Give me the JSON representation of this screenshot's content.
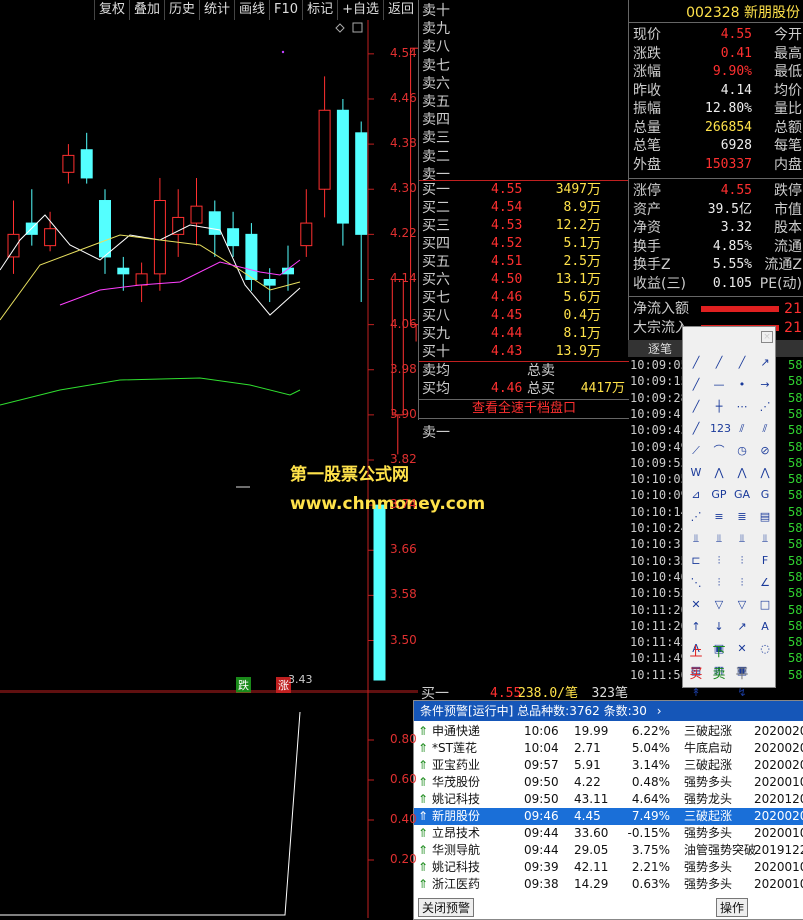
{
  "toolbar": [
    "复权",
    "叠加",
    "历史",
    "统计",
    "画线",
    "F10",
    "标记",
    "+自选",
    "返回"
  ],
  "price_axis": [
    "4.54",
    "4.46",
    "4.38",
    "4.30",
    "4.22",
    "4.14",
    "4.06",
    "3.98",
    "3.90",
    "3.82",
    "3.74",
    "3.66",
    "3.58",
    "3.50"
  ],
  "vol_axis": [
    "0.80",
    "0.60",
    "0.40",
    "0.20"
  ],
  "chart_marks": {
    "low_label": "3.43",
    "fall_tag": "跌",
    "rise_tag": "涨"
  },
  "watermark": {
    "line1": "第一股票公式网",
    "line2": "www.chnmoney.com"
  },
  "chart_data": {
    "type": "candlestick",
    "candles": [
      {
        "o": 4.18,
        "c": 4.22,
        "h": 4.28,
        "l": 4.15
      },
      {
        "o": 4.24,
        "c": 4.22,
        "h": 4.3,
        "l": 4.2
      },
      {
        "o": 4.2,
        "c": 4.23,
        "h": 4.26,
        "l": 4.19
      },
      {
        "o": 4.33,
        "c": 4.36,
        "h": 4.38,
        "l": 4.31
      },
      {
        "o": 4.37,
        "c": 4.32,
        "h": 4.4,
        "l": 4.31
      },
      {
        "o": 4.28,
        "c": 4.18,
        "h": 4.3,
        "l": 4.15
      },
      {
        "o": 4.16,
        "c": 4.15,
        "h": 4.18,
        "l": 4.12
      },
      {
        "o": 4.13,
        "c": 4.15,
        "h": 4.17,
        "l": 4.1
      },
      {
        "o": 4.15,
        "c": 4.28,
        "h": 4.32,
        "l": 4.12
      },
      {
        "o": 4.22,
        "c": 4.25,
        "h": 4.3,
        "l": 4.18
      },
      {
        "o": 4.24,
        "c": 4.27,
        "h": 4.32,
        "l": 4.2
      },
      {
        "o": 4.26,
        "c": 4.22,
        "h": 4.28,
        "l": 4.18
      },
      {
        "o": 4.23,
        "c": 4.2,
        "h": 4.26,
        "l": 4.18
      },
      {
        "o": 4.22,
        "c": 4.14,
        "h": 4.24,
        "l": 4.12
      },
      {
        "o": 4.14,
        "c": 4.13,
        "h": 4.16,
        "l": 4.1
      },
      {
        "o": 4.16,
        "c": 4.15,
        "h": 4.2,
        "l": 4.12
      },
      {
        "o": 4.2,
        "c": 4.24,
        "h": 4.3,
        "l": 4.18
      },
      {
        "o": 4.3,
        "c": 4.44,
        "h": 4.5,
        "l": 4.25
      },
      {
        "o": 4.44,
        "c": 4.24,
        "h": 4.46,
        "l": 4.2
      },
      {
        "o": 4.4,
        "c": 4.22,
        "h": 4.42,
        "l": 4.1
      },
      {
        "o": 3.74,
        "c": 3.43,
        "h": 3.74,
        "l": 3.43
      },
      {
        "o": 3.9,
        "c": 4.14,
        "h": 4.14,
        "l": 3.83
      },
      {
        "o": 4.06,
        "c": 4.55,
        "h": 4.55,
        "l": 4.03
      }
    ]
  },
  "stock": {
    "code": "002328",
    "name": "新朋股份"
  },
  "orderbook": {
    "sells": [
      "卖十",
      "卖九",
      "卖八",
      "卖七",
      "卖六",
      "卖五",
      "卖四",
      "卖三",
      "卖二",
      "卖一"
    ],
    "buys": [
      {
        "label": "买一",
        "price": "4.55",
        "vol": "3497"
      },
      {
        "label": "买二",
        "price": "4.54",
        "vol": "8.9"
      },
      {
        "label": "买三",
        "price": "4.53",
        "vol": "12.2"
      },
      {
        "label": "买四",
        "price": "4.52",
        "vol": "5.1"
      },
      {
        "label": "买五",
        "price": "4.51",
        "vol": "2.5"
      },
      {
        "label": "买六",
        "price": "4.50",
        "vol": "13.1"
      },
      {
        "label": "买七",
        "price": "4.46",
        "vol": "5.6"
      },
      {
        "label": "买八",
        "price": "4.45",
        "vol": "0.4"
      },
      {
        "label": "买九",
        "price": "4.44",
        "vol": "8.1"
      },
      {
        "label": "买十",
        "price": "4.43",
        "vol": "13.9"
      }
    ],
    "unit": "万",
    "sell_avg_label": "卖均",
    "total_sell_label": "总卖",
    "buy_avg_label": "买均",
    "buy_avg": "4.46",
    "total_buy_label": "总买",
    "total_buy": "4417万",
    "view_link": "查看全速千档盘口",
    "sell_one_label": "卖一",
    "bottom_row": {
      "label": "买一",
      "price": "4.55",
      "vol": "238.0/笔",
      "extra": "323笔"
    }
  },
  "quote": [
    {
      "l": "现价",
      "v": "4.55",
      "c": "red",
      "l2": "今开"
    },
    {
      "l": "涨跌",
      "v": "0.41",
      "c": "red",
      "l2": "最高"
    },
    {
      "l": "涨幅",
      "v": "9.90%",
      "c": "red",
      "l2": "最低"
    },
    {
      "l": "昨收",
      "v": "4.14",
      "c": "wht",
      "l2": "均价"
    },
    {
      "l": "振幅",
      "v": "12.80%",
      "c": "wht",
      "l2": "量比"
    },
    {
      "l": "总量",
      "v": "266854",
      "c": "yel",
      "l2": "总额"
    },
    {
      "l": "总笔",
      "v": "6928",
      "c": "wht",
      "l2": "每笔"
    },
    {
      "l": "外盘",
      "v": "150337",
      "c": "red",
      "l2": "内盘"
    },
    {
      "l": "涨停",
      "v": "4.55",
      "c": "red",
      "l2": "跌停"
    },
    {
      "l": "资产",
      "v": "39.5亿",
      "c": "wht",
      "l2": "市值"
    },
    {
      "l": "净资",
      "v": "3.32",
      "c": "wht",
      "l2": "股本"
    },
    {
      "l": "换手",
      "v": "4.85%",
      "c": "wht",
      "l2": "流通"
    },
    {
      "l": "换手Z",
      "v": "5.55%",
      "c": "wht",
      "l2": "流通Z"
    },
    {
      "l": "收益(三)",
      "v": "0.105",
      "c": "wht",
      "l2": "PE(动)"
    }
  ],
  "flow": [
    {
      "label": "净流入额",
      "value": "21"
    },
    {
      "label": "大宗流入",
      "value": "21"
    }
  ],
  "ticks_title": "逐笔",
  "ticks": [
    "10:09:05",
    "10:09:15",
    "10:09:28",
    "10:09:41",
    "10:09:43",
    "10:09:49",
    "10:09:53",
    "10:10:05",
    "10:10:09",
    "10:10:14",
    "10:10:24",
    "10:10:31",
    "10:10:35",
    "10:10:40",
    "10:10:52",
    "10:11:20",
    "10:11:26",
    "10:11:42",
    "10:11:49",
    "10:11:56"
  ],
  "toolbox": {
    "up": "上",
    "down": "下",
    "buy": "买",
    "sell": "卖",
    "flat": "平"
  },
  "alerts": {
    "title": "条件预警[运行中] 总品种数:3762 条数:30",
    "rows": [
      {
        "name": "申通快递",
        "time": "10:06",
        "price": "19.99",
        "pct": "6.22%",
        "sig": "三破起涨",
        "date": "20200204"
      },
      {
        "name": "*ST莲花",
        "time": "10:04",
        "price": "2.71",
        "pct": "5.04%",
        "sig": "牛底启动",
        "date": "20200203"
      },
      {
        "name": "亚宝药业",
        "time": "09:57",
        "price": "5.91",
        "pct": "3.14%",
        "sig": "三破起涨",
        "date": "20200204"
      },
      {
        "name": "华茂股份",
        "time": "09:50",
        "price": "4.22",
        "pct": "0.48%",
        "sig": "强势多头",
        "date": "20200104"
      },
      {
        "name": "姚记科技",
        "time": "09:50",
        "price": "43.11",
        "pct": "4.64%",
        "sig": "强势龙头",
        "date": "2020120-自"
      },
      {
        "name": "新朋股份",
        "time": "09:46",
        "price": "4.45",
        "pct": "7.49%",
        "sig": "三破起涨",
        "date": "20200204"
      },
      {
        "name": "立昂技术",
        "time": "09:44",
        "price": "33.60",
        "pct": "-0.15%",
        "sig": "强势多头",
        "date": "20200104-自"
      },
      {
        "name": "华测导航",
        "time": "09:44",
        "price": "29.05",
        "pct": "3.75%",
        "sig": "油管强势突破",
        "date": "2019122"
      },
      {
        "name": "姚记科技",
        "time": "09:39",
        "price": "42.11",
        "pct": "2.21%",
        "sig": "强势多头",
        "date": "20200104-自"
      },
      {
        "name": "浙江医药",
        "time": "09:38",
        "price": "14.29",
        "pct": "0.63%",
        "sig": "强势多头",
        "date": "20200104"
      }
    ],
    "close_btn": "关闭预警",
    "op_btn": "操作"
  }
}
